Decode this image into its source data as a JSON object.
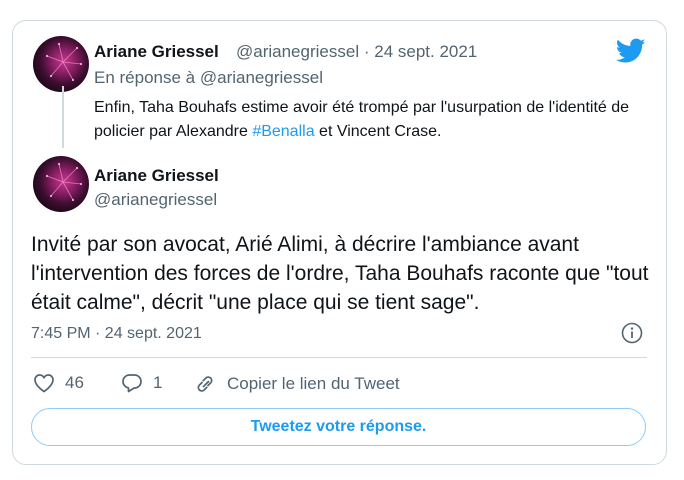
{
  "parent_tweet": {
    "display_name": "Ariane Griessel",
    "handle": "@arianegriessel",
    "separator": "·",
    "date": "24 sept. 2021",
    "reply_prefix": "En réponse à",
    "reply_handle": "@arianegriessel",
    "text_before": "Enfin, Taha Bouhafs estime avoir été trompé par l'usurpation de l'identité de policier par Alexandre ",
    "hashtag": "#Benalla",
    "text_after": " et Vincent Crase."
  },
  "main_tweet": {
    "display_name": "Ariane Griessel",
    "handle": "@arianegriessel",
    "text": "Invité par son avocat, Arié Alimi, à décrire l'ambiance avant l'intervention des forces de l'ordre, Taha Bouhafs raconte que \"tout était calme\", décrit \"une place qui se tient sage\".",
    "timestamp": "7:45 PM · 24 sept. 2021"
  },
  "actions": {
    "like_count": "46",
    "reply_count": "1",
    "copy_link_label": "Copier le lien du Tweet"
  },
  "reply_button_label": "Tweetez votre réponse.",
  "icons": {
    "brand": "twitter-bird-icon",
    "like": "heart-icon",
    "reply": "speech-bubble-icon",
    "copy": "link-icon",
    "info": "info-icon"
  },
  "colors": {
    "accent": "#1d9bf0",
    "text": "#0f1419",
    "muted": "#536471",
    "border": "#cfd9de"
  }
}
